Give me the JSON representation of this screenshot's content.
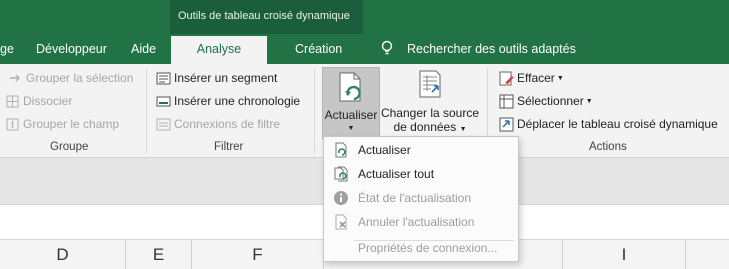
{
  "context_tab_group": "Outils de tableau croisé dynamique",
  "tabs": [
    {
      "label": "ge"
    },
    {
      "label": "Développeur"
    },
    {
      "label": "Aide"
    },
    {
      "label": "Analyse",
      "active": true
    },
    {
      "label": "Création"
    }
  ],
  "tell_me": "Rechercher des outils adaptés",
  "groups": {
    "groupe": {
      "label": "Groupe",
      "items": [
        "Grouper la sélection",
        "Dissocier",
        "Grouper le champ"
      ]
    },
    "filtrer": {
      "label": "Filtrer",
      "items": [
        "Insérer un segment",
        "Insérer une chronologie",
        "Connexions de filtre"
      ]
    },
    "donnees": {
      "actualiser": "Actualiser",
      "changer_line1": "Changer la source",
      "changer_line2": "de données"
    },
    "actions": {
      "label": "Actions",
      "items": [
        "Effacer",
        "Sélectionner",
        "Déplacer le tableau croisé dynamique"
      ]
    }
  },
  "dropdown": {
    "items": [
      "Actualiser",
      "Actualiser tout",
      "État de l'actualisation",
      "Annuler l'actualisation",
      "Propriétés de connexion..."
    ]
  },
  "columns": [
    "D",
    "E",
    "F",
    "I"
  ],
  "colors": {
    "ribbon_green": "#217346",
    "context_band": "#1b5e3b",
    "refresh_green": "#2e8b57",
    "info_gray": "#a0a0a0"
  },
  "icons": [
    "lightbulb-icon",
    "group-selection-icon",
    "ungroup-icon",
    "group-field-icon",
    "slicer-icon",
    "timeline-icon",
    "filter-connections-icon",
    "refresh-doc-icon",
    "change-source-icon",
    "eraser-icon",
    "select-icon",
    "move-table-icon",
    "refresh-icon",
    "refresh-all-icon",
    "info-icon",
    "cancel-refresh-icon"
  ]
}
